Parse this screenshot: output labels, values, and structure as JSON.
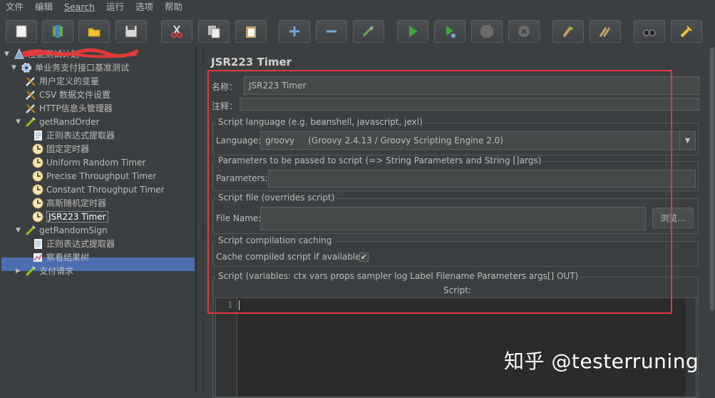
{
  "menu": [
    "文件",
    "编辑",
    "Search",
    "运行",
    "选项",
    "帮助"
  ],
  "toolbar": {
    "buttons": [
      "new-icon",
      "templates-icon",
      "open-icon",
      "save-icon",
      "cut-icon",
      "copy-icon",
      "paste-icon",
      "expand-icon",
      "collapse-icon",
      "toggle-icon",
      "start-icon",
      "start-no-pause-icon",
      "stop-icon",
      "shutdown-icon",
      "clear-icon",
      "clear-all-icon",
      "search-icon",
      "reset-search-icon"
    ]
  },
  "tree": {
    "items": [
      {
        "label": "性能测试计划",
        "level": 0,
        "icon": "test-plan-icon",
        "expanded": true
      },
      {
        "label": "单业务支付接口基准测试",
        "level": 1,
        "icon": "thread-group-icon",
        "expanded": true
      },
      {
        "label": "用户定义的变量",
        "level": 2,
        "icon": "config-element-icon"
      },
      {
        "label": "CSV 数据文件设置",
        "level": 2,
        "icon": "config-element-icon"
      },
      {
        "label": "HTTP信息头管理器",
        "level": 2,
        "icon": "config-element-icon"
      },
      {
        "label": "getRandOrder",
        "level": 2,
        "icon": "sampler-icon",
        "expanded": true
      },
      {
        "label": "正则表达式提取器",
        "level": 3,
        "icon": "post-processor-icon"
      },
      {
        "label": "固定定时器",
        "level": 3,
        "icon": "timer-icon"
      },
      {
        "label": "Uniform Random Timer",
        "level": 3,
        "icon": "timer-icon"
      },
      {
        "label": "Precise Throughput Timer",
        "level": 3,
        "icon": "timer-icon"
      },
      {
        "label": "Constant Throughput Timer",
        "level": 3,
        "icon": "timer-icon"
      },
      {
        "label": "高斯随机定时器",
        "level": 3,
        "icon": "timer-icon"
      },
      {
        "label": "JSR223 Timer",
        "level": 3,
        "icon": "timer-icon",
        "selected": true
      },
      {
        "label": "getRandomSign",
        "level": 2,
        "icon": "sampler-icon",
        "expanded": true
      },
      {
        "label": "正则表达式提取器",
        "level": 3,
        "icon": "post-processor-icon"
      },
      {
        "label": "察看结果树",
        "level": 3,
        "icon": "listener-icon"
      },
      {
        "label": "支付请求",
        "level": 2,
        "icon": "sampler-icon",
        "expanded": false
      }
    ]
  },
  "panel": {
    "title": "JSR223 Timer",
    "name_label": "名称：",
    "name_value": "JSR223 Timer",
    "comment_label": "注释：",
    "comment_value": "",
    "language_group": "Script language (e.g. beanshell, javascript, jexl)",
    "language_label": "Language:",
    "language_value": "groovy     (Groovy 2.4.13 / Groovy Scripting Engine 2.0)",
    "params_group": "Parameters to be passed to script (=> String Parameters and String []args)",
    "params_label": "Parameters:",
    "params_value": "",
    "file_group": "Script file (overrides script)",
    "file_label": "File Name:",
    "file_value": "",
    "browse_label": "浏览...",
    "cache_group": "Script compilation caching",
    "cache_label": "Cache compiled script if available:",
    "cache_checked": true,
    "script_group": "Script (variables: ctx vars props sampler log Label Filename Parameters args[] OUT)",
    "script_header": "Script:",
    "line_number": "1"
  },
  "watermark": "知乎 @testerruning",
  "colors": {
    "accent": "#4b6eaf",
    "annotation": "#e03a3a",
    "background": "#3c3f41"
  }
}
